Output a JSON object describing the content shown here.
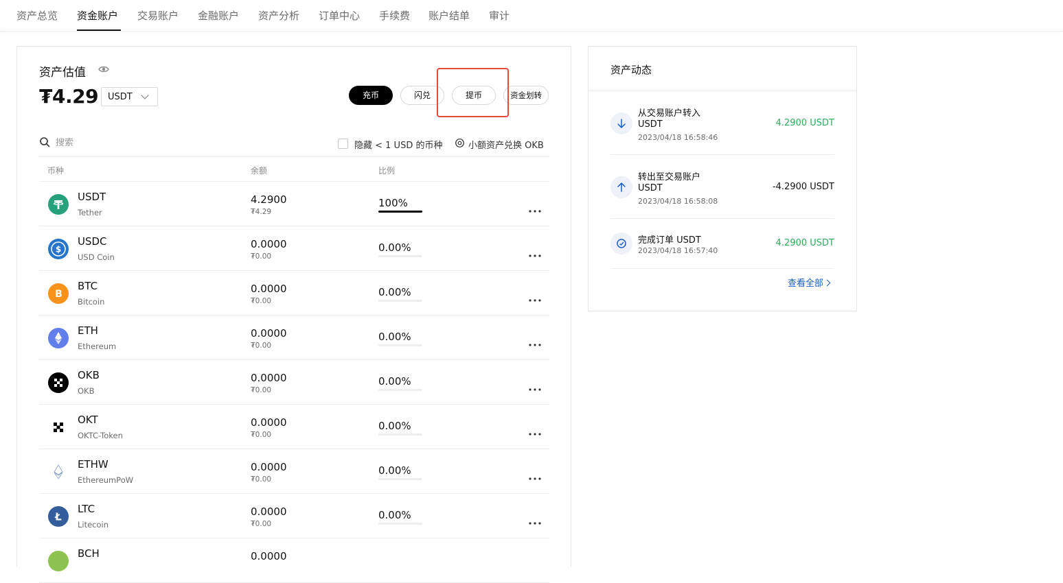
{
  "nav": {
    "tabs": [
      "资产总览",
      "资金账户",
      "交易账户",
      "金融账户",
      "资产分析",
      "订单中心",
      "手续费",
      "账户结单",
      "审计"
    ],
    "active_index": 1
  },
  "valuation": {
    "title": "资产估值",
    "amount": "₮4.29",
    "currency": "USDT"
  },
  "actions": {
    "deposit": "充币",
    "convert": "闪兑",
    "withdraw": "提币",
    "transfer": "资金划转"
  },
  "filters": {
    "search_placeholder": "搜索",
    "hide_small": "隐藏 < 1 USD 的币种",
    "small_convert": "小额资产兑换 OKB"
  },
  "table": {
    "headers": [
      "币种",
      "余额",
      "比例"
    ],
    "rows": [
      {
        "symbol": "USDT",
        "name": "Tether",
        "balance": "4.2900",
        "value": "₮4.29",
        "pct": "100%",
        "fill": 1.0,
        "color": "#26a17b",
        "icon": "tether-icon"
      },
      {
        "symbol": "USDC",
        "name": "USD Coin",
        "balance": "0.0000",
        "value": "₮0.00",
        "pct": "0.00%",
        "fill": 0,
        "color": "#2775ca",
        "icon": "usdc-icon"
      },
      {
        "symbol": "BTC",
        "name": "Bitcoin",
        "balance": "0.0000",
        "value": "₮0.00",
        "pct": "0.00%",
        "fill": 0,
        "color": "#f7931a",
        "icon": "bitcoin-icon"
      },
      {
        "symbol": "ETH",
        "name": "Ethereum",
        "balance": "0.0000",
        "value": "₮0.00",
        "pct": "0.00%",
        "fill": 0,
        "color": "#627eea",
        "icon": "ethereum-icon"
      },
      {
        "symbol": "OKB",
        "name": "OKB",
        "balance": "0.0000",
        "value": "₮0.00",
        "pct": "0.00%",
        "fill": 0,
        "color": "#000000",
        "icon": "okb-icon"
      },
      {
        "symbol": "OKT",
        "name": "OKTC-Token",
        "balance": "0.0000",
        "value": "₮0.00",
        "pct": "0.00%",
        "fill": 0,
        "color": "#ffffff",
        "icon": "okt-icon"
      },
      {
        "symbol": "ETHW",
        "name": "EthereumPoW",
        "balance": "0.0000",
        "value": "₮0.00",
        "pct": "0.00%",
        "fill": 0,
        "color": "#ffffff",
        "icon": "ethw-icon"
      },
      {
        "symbol": "LTC",
        "name": "Litecoin",
        "balance": "0.0000",
        "value": "₮0.00",
        "pct": "0.00%",
        "fill": 0,
        "color": "#345d9d",
        "icon": "litecoin-icon"
      },
      {
        "symbol": "BCH",
        "name": "",
        "balance": "0.0000",
        "value": "",
        "pct": "",
        "fill": 0,
        "color": "#8dc351",
        "icon": "bitcoin-cash-icon"
      }
    ]
  },
  "activity": {
    "title": "资产动态",
    "items": [
      {
        "line1": "从交易账户转入",
        "line2": "USDT",
        "time": "2023/04/18 16:58:46",
        "amount": "4.2900 USDT",
        "color": "#2eaa5c",
        "icon": "arrow-down-icon"
      },
      {
        "line1": "转出至交易账户",
        "line2": "USDT",
        "time": "2023/04/18 16:58:08",
        "amount": "-4.2900 USDT",
        "color": "#121212",
        "icon": "arrow-up-icon"
      },
      {
        "line1": "完成订单 USDT",
        "line2": "",
        "time": "2023/04/18 16:57:40",
        "amount": "4.2900 USDT",
        "color": "#2eaa5c",
        "icon": "order-complete-icon"
      }
    ],
    "view_all": "查看全部"
  },
  "colors": {
    "accent_box": "#e5493e",
    "link": "#1a5dc8",
    "positive": "#2eaa5c"
  }
}
